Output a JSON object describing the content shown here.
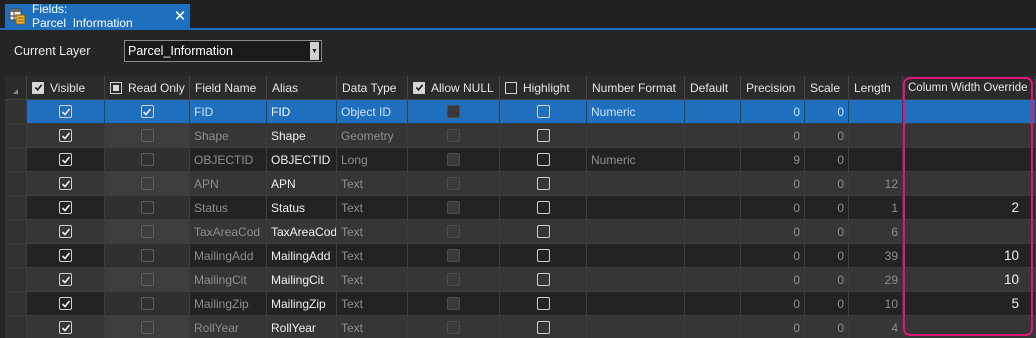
{
  "tab": {
    "title": "Fields: Parcel_Information",
    "icon": "table-fields-icon",
    "close_label": "✕"
  },
  "accent": "#1f6fbf",
  "highlight_color": "#e0157a",
  "layer": {
    "label": "Current Layer",
    "value": "Parcel_Information"
  },
  "columns": {
    "visible": "Visible",
    "read_only": "Read Only",
    "field_name": "Field Name",
    "alias": "Alias",
    "data_type": "Data Type",
    "allow_null": "Allow NULL",
    "highlight": "Highlight",
    "number_format": "Number Format",
    "default": "Default",
    "precision": "Precision",
    "scale": "Scale",
    "length": "Length",
    "column_width_override": "Column Width Override"
  },
  "rows": [
    {
      "visible": true,
      "read_only": true,
      "field_name": "FID",
      "alias": "FID",
      "data_type": "Object ID",
      "allow_null": "disabled",
      "highlight": false,
      "number_format": "Numeric",
      "default": "",
      "precision": "0",
      "scale": "0",
      "length": "",
      "override": ""
    },
    {
      "visible": true,
      "read_only": false,
      "field_name": "Shape",
      "alias": "Shape",
      "data_type": "Geometry",
      "allow_null": "disabled",
      "highlight": false,
      "number_format": "",
      "default": "",
      "precision": "0",
      "scale": "0",
      "length": "",
      "override": ""
    },
    {
      "visible": true,
      "read_only": false,
      "field_name": "OBJECTID",
      "alias": "OBJECTID",
      "data_type": "Long",
      "allow_null": "disabled",
      "highlight": false,
      "number_format": "Numeric",
      "default": "",
      "precision": "9",
      "scale": "0",
      "length": "",
      "override": ""
    },
    {
      "visible": true,
      "read_only": false,
      "field_name": "APN",
      "alias": "APN",
      "data_type": "Text",
      "allow_null": "disabled",
      "highlight": false,
      "number_format": "",
      "default": "",
      "precision": "0",
      "scale": "0",
      "length": "12",
      "override": ""
    },
    {
      "visible": true,
      "read_only": false,
      "field_name": "Status",
      "alias": "Status",
      "data_type": "Text",
      "allow_null": "disabled",
      "highlight": false,
      "number_format": "",
      "default": "",
      "precision": "0",
      "scale": "0",
      "length": "1",
      "override": "2"
    },
    {
      "visible": true,
      "read_only": false,
      "field_name": "TaxAreaCod",
      "alias": "TaxAreaCod",
      "data_type": "Text",
      "allow_null": "disabled",
      "highlight": false,
      "number_format": "",
      "default": "",
      "precision": "0",
      "scale": "0",
      "length": "6",
      "override": ""
    },
    {
      "visible": true,
      "read_only": false,
      "field_name": "MailingAdd",
      "alias": "MailingAdd",
      "data_type": "Text",
      "allow_null": "disabled",
      "highlight": false,
      "number_format": "",
      "default": "",
      "precision": "0",
      "scale": "0",
      "length": "39",
      "override": "10"
    },
    {
      "visible": true,
      "read_only": false,
      "field_name": "MailingCit",
      "alias": "MailingCit",
      "data_type": "Text",
      "allow_null": "disabled",
      "highlight": false,
      "number_format": "",
      "default": "",
      "precision": "0",
      "scale": "0",
      "length": "29",
      "override": "10"
    },
    {
      "visible": true,
      "read_only": false,
      "field_name": "MailingZip",
      "alias": "MailingZip",
      "data_type": "Text",
      "allow_null": "disabled",
      "highlight": false,
      "number_format": "",
      "default": "",
      "precision": "0",
      "scale": "0",
      "length": "10",
      "override": "5"
    },
    {
      "visible": true,
      "read_only": false,
      "field_name": "RollYear",
      "alias": "RollYear",
      "data_type": "Text",
      "allow_null": "disabled",
      "highlight": false,
      "number_format": "",
      "default": "",
      "precision": "0",
      "scale": "0",
      "length": "4",
      "override": ""
    }
  ]
}
